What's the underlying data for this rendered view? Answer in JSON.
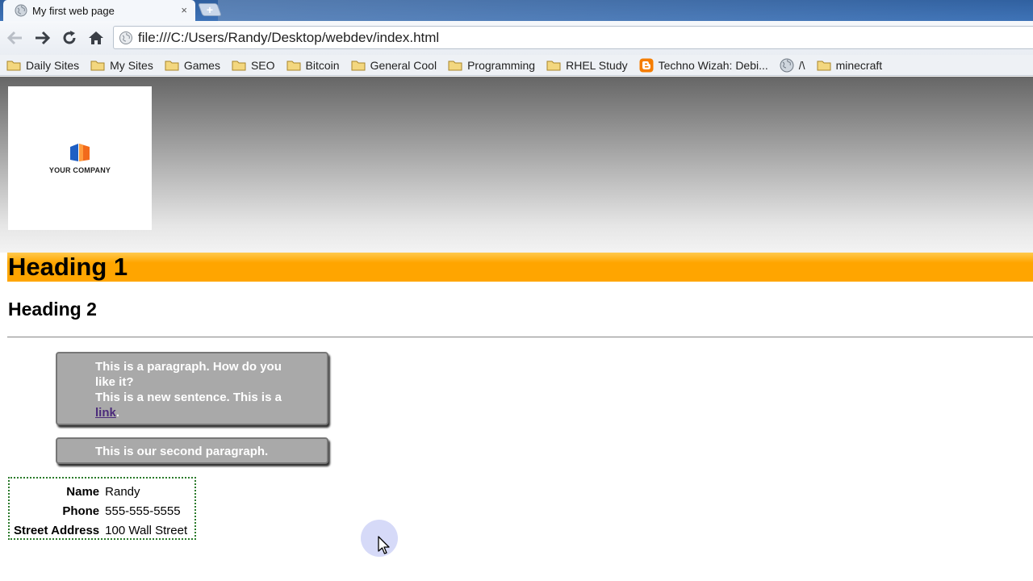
{
  "browser": {
    "tab": {
      "title": "My first web page",
      "close_glyph": "×"
    },
    "newtab_glyph": "+",
    "address": {
      "url": "file:///C:/Users/Randy/Desktop/webdev/index.html"
    },
    "bookmarks": [
      {
        "label": "Daily Sites",
        "icon": "folder-icon"
      },
      {
        "label": "My Sites",
        "icon": "folder-icon"
      },
      {
        "label": "Games",
        "icon": "folder-icon"
      },
      {
        "label": "SEO",
        "icon": "folder-icon"
      },
      {
        "label": "Bitcoin",
        "icon": "folder-icon"
      },
      {
        "label": "General Cool",
        "icon": "folder-icon"
      },
      {
        "label": "Programming",
        "icon": "folder-icon"
      },
      {
        "label": "RHEL Study",
        "icon": "folder-icon"
      },
      {
        "label": "Techno Wizah: Debi...",
        "icon": "blogger-icon"
      },
      {
        "label": "/\\",
        "icon": "globe-icon"
      },
      {
        "label": "minecraft",
        "icon": "folder-icon"
      }
    ]
  },
  "page": {
    "logo_text": "YOUR COMPANY",
    "heading1": "Heading 1",
    "heading2": "Heading 2",
    "paragraph1": {
      "line1": "This is a paragraph. How do you like it?",
      "line2_prefix": "This is a new sentence. This is a ",
      "link": "link",
      "line2_suffix": "."
    },
    "paragraph2": "This is our second paragraph.",
    "info": [
      {
        "label": "Name",
        "value": "Randy"
      },
      {
        "label": "Phone",
        "value": "555-555-5555"
      },
      {
        "label": "Street Address",
        "value": "100 Wall Street"
      }
    ]
  },
  "colors": {
    "heading1_bg": "#ffa500",
    "paragraph_bg": "#a9a9a9",
    "link": "#4b2a7b",
    "info_border": "#2a7a2a",
    "tabstrip": "#3f74b8"
  }
}
